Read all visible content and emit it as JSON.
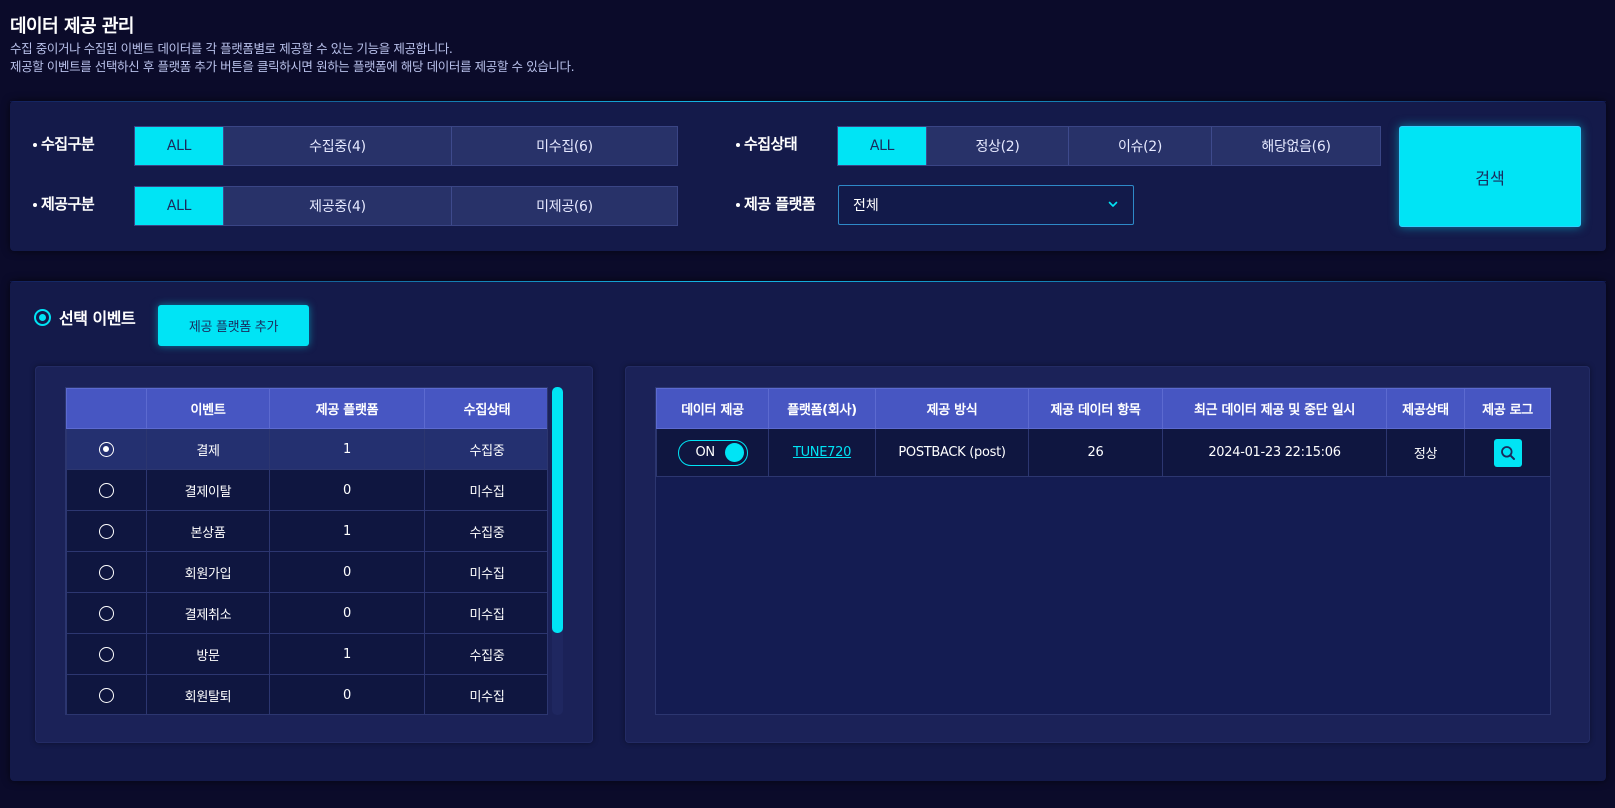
{
  "page": {
    "title": "데이터 제공 관리",
    "desc1": "수집 중이거나 수집된 이벤트 데이터를 각 플랫폼별로 제공할 수 있는 기능을 제공합니다.",
    "desc2": "제공할 이벤트를 선택하신 후 플랫폼 추가 버튼을 클릭하시면 원하는 플랫폼에 해당 데이터를 제공할 수 있습니다."
  },
  "filters": {
    "collect_type": {
      "label": "수집구분",
      "options": [
        "ALL",
        "수집중(4)",
        "미수집(6)"
      ],
      "selected": "ALL"
    },
    "provide_type": {
      "label": "제공구분",
      "options": [
        "ALL",
        "제공중(4)",
        "미제공(6)"
      ],
      "selected": "ALL"
    },
    "collect_status": {
      "label": "수집상태",
      "options": [
        "ALL",
        "정상(2)",
        "이슈(2)",
        "해당없음(6)"
      ],
      "selected": "ALL"
    },
    "provide_platform": {
      "label": "제공 플랫폼",
      "value": "전체"
    },
    "search_label": "검색"
  },
  "events_section": {
    "title": "선택 이벤트",
    "add_button": "제공 플랫폼 추가",
    "columns": [
      "",
      "이벤트",
      "제공 플랫폼",
      "수집상태"
    ],
    "rows": [
      {
        "event": "결제",
        "platforms": "1",
        "status": "수집중",
        "selected": true
      },
      {
        "event": "결제이탈",
        "platforms": "0",
        "status": "미수집",
        "selected": false
      },
      {
        "event": "본상품",
        "platforms": "1",
        "status": "수집중",
        "selected": false
      },
      {
        "event": "회원가입",
        "platforms": "0",
        "status": "미수집",
        "selected": false
      },
      {
        "event": "결제취소",
        "platforms": "0",
        "status": "미수집",
        "selected": false
      },
      {
        "event": "방문",
        "platforms": "1",
        "status": "수집중",
        "selected": false
      },
      {
        "event": "회원탈퇴",
        "platforms": "0",
        "status": "미수집",
        "selected": false
      }
    ]
  },
  "platforms_section": {
    "columns": [
      "데이터 제공",
      "플랫폼(회사)",
      "제공 방식",
      "제공 데이터 항목",
      "최근 데이터 제공 및 중단 일시",
      "제공상태",
      "제공 로그"
    ],
    "rows": [
      {
        "toggle": "ON",
        "platform": "TUNE720",
        "method": "POSTBACK (post)",
        "items": "26",
        "last_time": "2024-01-23 22:15:06",
        "status": "정상"
      }
    ]
  },
  "colors": {
    "accent": "#00e4f5",
    "background": "#0b0b2a",
    "panel": "#141a4a",
    "table_header": "#4756c2"
  },
  "icons": {
    "search": "search-icon",
    "dropdown": "chevron-down-icon"
  }
}
